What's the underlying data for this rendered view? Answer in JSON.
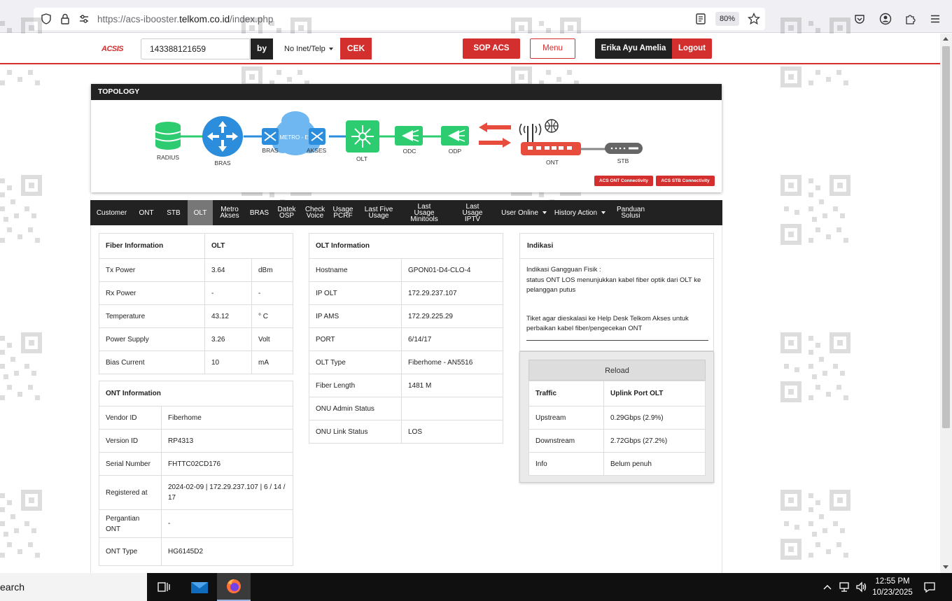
{
  "browser": {
    "url_prefix": "https://acs-ibooster.",
    "url_domain": "telkom.co.id",
    "url_suffix": "/index.php",
    "zoom": "80%"
  },
  "header": {
    "logo": "ACSIS",
    "search_value": "143388121659",
    "by_label": "by",
    "search_type": "No Inet/Telp",
    "cek_label": "CEK",
    "sop_label": "SOP ACS",
    "menu_label": "Menu",
    "user_name": "Erika Ayu Amelia",
    "logout_label": "Logout"
  },
  "topology": {
    "title": "TOPOLOGY",
    "nodes": {
      "radius": "RADIUS",
      "bras": "BRAS",
      "bras_metro": "BRAS",
      "metro": "METRO - E",
      "akses": "AKSES",
      "olt": "OLT",
      "odc": "ODC",
      "odp": "ODP",
      "ont": "ONT",
      "stb": "STB"
    },
    "ont_conn_label": "ACS ONT Connectivity",
    "stb_conn_label": "ACS STB Connectivity",
    "colors": {
      "blue": "#2b8ddb",
      "green": "#2ecc71",
      "red": "#e74c3c",
      "dark": "#333333"
    }
  },
  "tabs": [
    {
      "label": "Customer"
    },
    {
      "label": "ONT"
    },
    {
      "label": "STB"
    },
    {
      "label": "OLT",
      "active": true
    },
    {
      "label": "Metro Akses"
    },
    {
      "label": "BRAS"
    },
    {
      "label": "Datek OSP"
    },
    {
      "label": "Check Voice"
    },
    {
      "label": "Usage PCRF"
    },
    {
      "label": "Last Five Usage"
    },
    {
      "label": "Last Usage Minitools"
    },
    {
      "label": "Last Usage IPTV"
    },
    {
      "label": "User Online",
      "dropdown": true
    },
    {
      "label": "History Action",
      "dropdown": true
    },
    {
      "label": "Panduan Solusi"
    }
  ],
  "fiber": {
    "header": [
      "Fiber Information",
      "OLT"
    ],
    "rows": [
      [
        "Tx Power",
        "3.64",
        "dBm"
      ],
      [
        "Rx Power",
        "-",
        "-"
      ],
      [
        "Temperature",
        "43.12",
        "° C"
      ],
      [
        "Power Supply",
        "3.26",
        "Volt"
      ],
      [
        "Bias Current",
        "10",
        "mA"
      ]
    ]
  },
  "ont": {
    "header": "ONT Information",
    "rows": [
      [
        "Vendor ID",
        "Fiberhome"
      ],
      [
        "Version ID",
        "RP4313"
      ],
      [
        "Serial Number",
        "FHTTC02CD176"
      ],
      [
        "Registered at",
        "2024-02-09 | 172.29.237.107 | 6 / 14 / 17"
      ],
      [
        "Pergantian ONT",
        "-"
      ],
      [
        "ONT Type",
        "HG6145D2"
      ]
    ]
  },
  "olt": {
    "header": "OLT Information",
    "rows": [
      [
        "Hostname",
        "GPON01-D4-CLO-4"
      ],
      [
        "IP OLT",
        "172.29.237.107"
      ],
      [
        "IP AMS",
        "172.29.225.29"
      ],
      [
        "PORT",
        "6/14/17"
      ],
      [
        "OLT Type",
        "Fiberhome - AN5516"
      ],
      [
        "Fiber Length",
        "1481 M"
      ],
      [
        "ONU Admin Status",
        ""
      ],
      [
        "ONU Link Status",
        "LOS"
      ]
    ]
  },
  "indikasi": {
    "title": "Indikasi",
    "line1": "Indikasi Gangguan Fisik :",
    "line2": "status ONT LOS menunjukkan kabel fiber optik dari OLT ke pelanggan putus",
    "line3": "Tiket agar dieskalasi ke Help Desk Telkom Akses untuk perbaikan kabel fiber/pengecekan ONT"
  },
  "traffic": {
    "reload_label": "Reload",
    "header": [
      "Traffic",
      "Uplink Port OLT"
    ],
    "rows": [
      [
        "Upstream",
        "0.29Gbps (2.9%)"
      ],
      [
        "Downstream",
        "2.72Gbps (27.2%)"
      ],
      [
        "Info",
        "Belum penuh"
      ]
    ]
  },
  "taskbar": {
    "search_text": "earch",
    "time": "12:55 PM",
    "date": "10/23/2025"
  }
}
